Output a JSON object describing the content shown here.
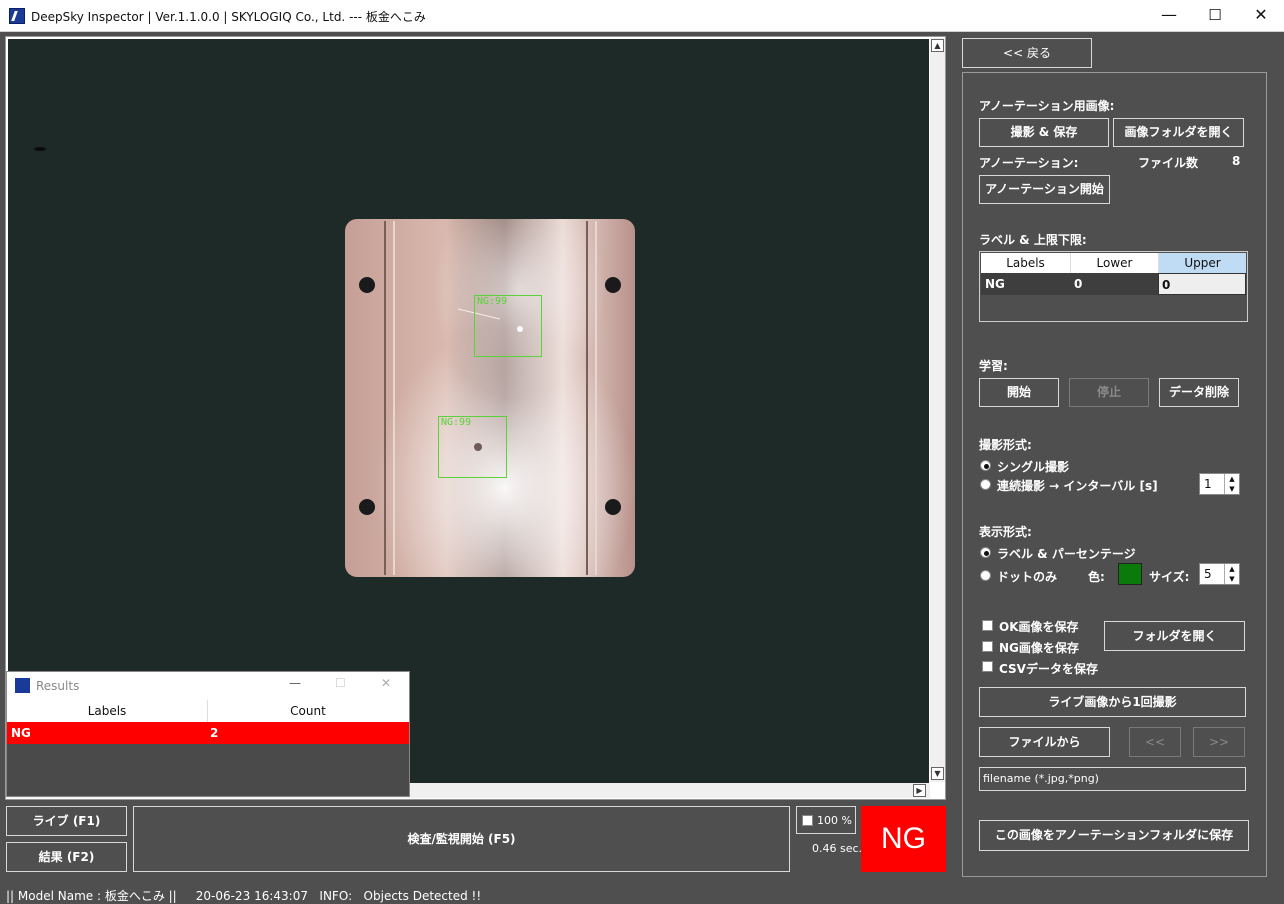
{
  "window": {
    "title": "DeepSky Inspector | Ver.1.1.0.0 | SKYLOGIQ Co., Ltd. --- 板金へこみ",
    "minimize": "—",
    "maximize": "☐",
    "close": "✕"
  },
  "viewer": {
    "detections": [
      {
        "label": "NG:99"
      },
      {
        "label": "NG:99"
      }
    ]
  },
  "results_window": {
    "title": "Results",
    "columns": [
      "Labels",
      "Count"
    ],
    "rows": [
      {
        "label": "NG",
        "count": "2"
      }
    ]
  },
  "bottom": {
    "live_button": "ライブ (F1)",
    "result_button": "結果 (F2)",
    "inspect_button": "検査/監視開始 (F5)",
    "zoom": "100 %",
    "time": "0.46 sec.",
    "judgement": "NG"
  },
  "panel": {
    "back_button": "<< 戻る",
    "annotation_images_label": "アノーテーション用画像:",
    "capture_save_button": "撮影 & 保存",
    "open_image_folder_button": "画像フォルダを開く",
    "annotation_label": "アノーテーション:",
    "file_count_label": "ファイル数",
    "file_count": "8",
    "start_annotation_button": "アノーテーション開始",
    "label_limits_label": "ラベル & 上限下限:",
    "limits_table": {
      "columns": [
        "Labels",
        "Lower",
        "Upper"
      ],
      "rows": [
        {
          "label": "NG",
          "lower": "0",
          "upper": "0"
        }
      ]
    },
    "training_label": "学習:",
    "train_start_button": "開始",
    "train_stop_button": "停止",
    "delete_data_button": "データ削除",
    "capture_mode_label": "撮影形式:",
    "capture_single": "シングル撮影",
    "capture_continuous": "連続撮影 → インターバル [s]",
    "interval_value": "1",
    "display_mode_label": "表示形式:",
    "display_label_percent": "ラベル & パーセンテージ",
    "display_dot_only": "ドットのみ",
    "color_label": "色:",
    "dot_color": "#0a7a0a",
    "size_label": "サイズ:",
    "size_value": "5",
    "save_ok_images": "OK画像を保存",
    "save_ng_images": "NG画像を保存",
    "save_csv": "CSVデータを保存",
    "open_folder_button": "フォルダを開く",
    "capture_once_button": "ライブ画像から1回撮影",
    "from_file_button": "ファイルから",
    "prev_button": "<<",
    "next_button": ">>",
    "filename_placeholder": "filename (*.jpg,*png)",
    "save_to_annotation_button": "この画像をアノーテーションフォルダに保存"
  },
  "status_bar": {
    "text": "|| Model Name : 板金へこみ ||     20-06-23 16:43:07   INFO:   Objects Detected !!"
  }
}
